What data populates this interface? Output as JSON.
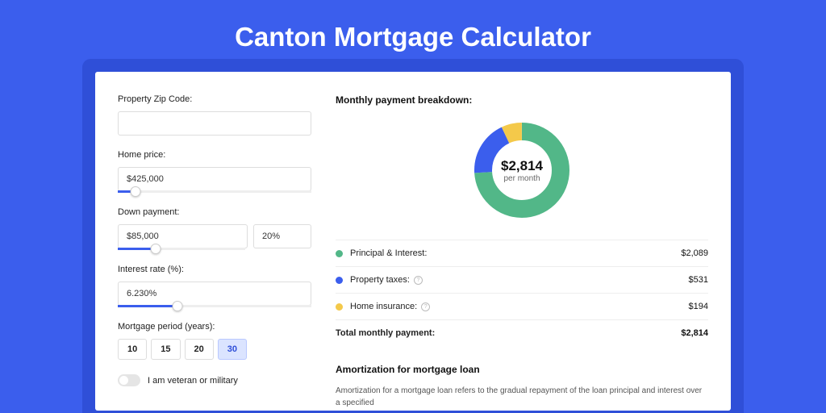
{
  "title": "Canton Mortgage Calculator",
  "form": {
    "zip_label": "Property Zip Code:",
    "zip_value": "",
    "price_label": "Home price:",
    "price_value": "$425,000",
    "price_slider_pct": 9,
    "down_label": "Down payment:",
    "down_value": "$85,000",
    "down_pct": "20%",
    "down_slider_pct": 20,
    "rate_label": "Interest rate (%):",
    "rate_value": "6.230%",
    "rate_slider_pct": 31,
    "period_label": "Mortgage period (years):",
    "periods": [
      "10",
      "15",
      "20",
      "30"
    ],
    "period_selected": "30",
    "veteran_label": "I am veteran or military"
  },
  "breakdown": {
    "title": "Monthly payment breakdown:",
    "center_value": "$2,814",
    "center_sub": "per month",
    "items": [
      {
        "label": "Principal & Interest:",
        "value": "$2,089",
        "color": "#52b788",
        "info": false,
        "pct": 74
      },
      {
        "label": "Property taxes:",
        "value": "$531",
        "color": "#3b5eed",
        "info": true,
        "pct": 19
      },
      {
        "label": "Home insurance:",
        "value": "$194",
        "color": "#f4c94a",
        "info": true,
        "pct": 7
      }
    ],
    "total_label": "Total monthly payment:",
    "total_value": "$2,814"
  },
  "amort": {
    "title": "Amortization for mortgage loan",
    "text": "Amortization for a mortgage loan refers to the gradual repayment of the loan principal and interest over a specified"
  },
  "chart_data": {
    "type": "pie",
    "title": "Monthly payment breakdown",
    "categories": [
      "Principal & Interest",
      "Property taxes",
      "Home insurance"
    ],
    "values": [
      2089,
      531,
      194
    ],
    "colors": [
      "#52b788",
      "#3b5eed",
      "#f4c94a"
    ],
    "total": 2814
  }
}
